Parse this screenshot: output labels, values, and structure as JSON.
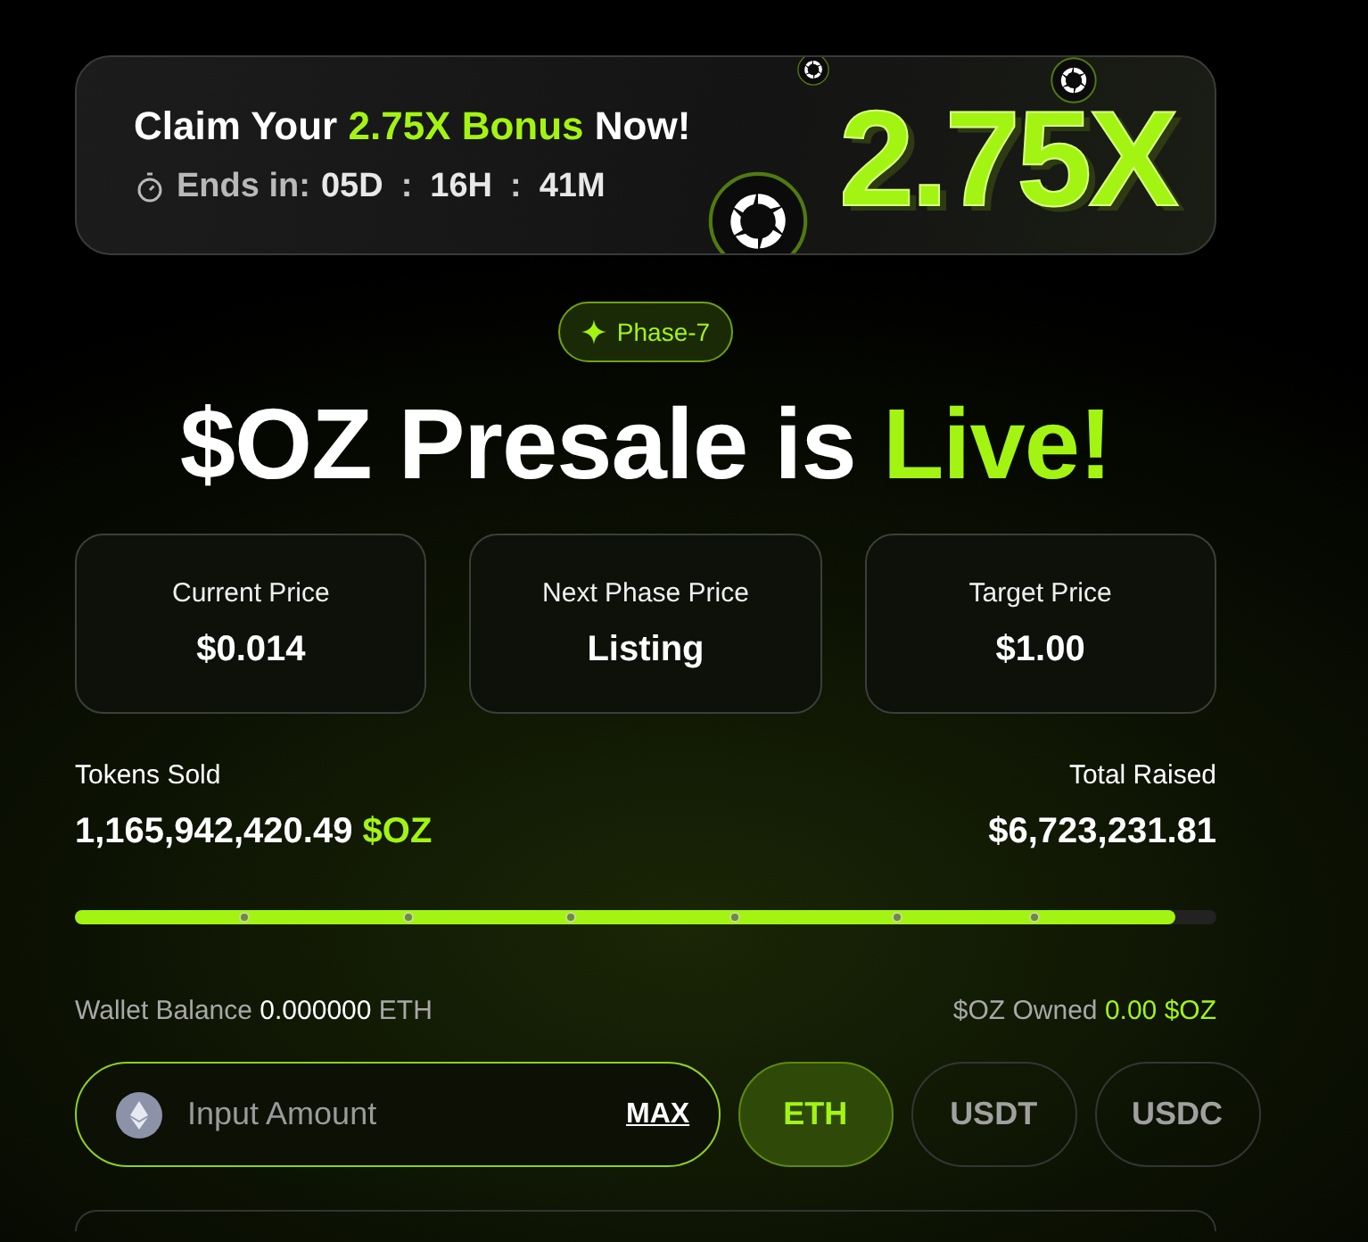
{
  "banner": {
    "title_before": "Claim Your",
    "title_highlight": "2.75X Bonus",
    "title_after": "Now!",
    "countdown_label": "Ends in:",
    "countdown": [
      {
        "kind": "value",
        "text": "05D"
      },
      {
        "kind": "sep",
        "text": ":"
      },
      {
        "kind": "value",
        "text": "16H"
      },
      {
        "kind": "sep",
        "text": ":"
      },
      {
        "kind": "value",
        "text": "41M"
      }
    ],
    "multiplier": "2.75X"
  },
  "phase_badge": "Phase-7",
  "headline": {
    "text": "$OZ Presale is",
    "highlight": "Live!"
  },
  "price_cards": [
    {
      "label": "Current Price",
      "value": "$0.014"
    },
    {
      "label": "Next Phase Price",
      "value": "Listing"
    },
    {
      "label": "Target Price",
      "value": "$1.00"
    }
  ],
  "stats": {
    "sold_label": "Tokens Sold",
    "sold_value": "1,165,942,420.49",
    "sold_unit": "$OZ",
    "raised_label": "Total Raised",
    "raised_value": "$6,723,231.81"
  },
  "progress": {
    "level": 0.964
  },
  "wallet": {
    "balance_label": "Wallet Balance",
    "balance_value": "0.000000",
    "balance_unit": "ETH",
    "owned_label": "$OZ Owned",
    "owned_value": "0.00 $OZ"
  },
  "amount_input": {
    "placeholder": "Input Amount",
    "max_label": "MAX"
  },
  "currencies": [
    {
      "label": "ETH",
      "selected": true
    },
    {
      "label": "USDT",
      "selected": false
    },
    {
      "label": "USDC",
      "selected": false
    }
  ]
}
